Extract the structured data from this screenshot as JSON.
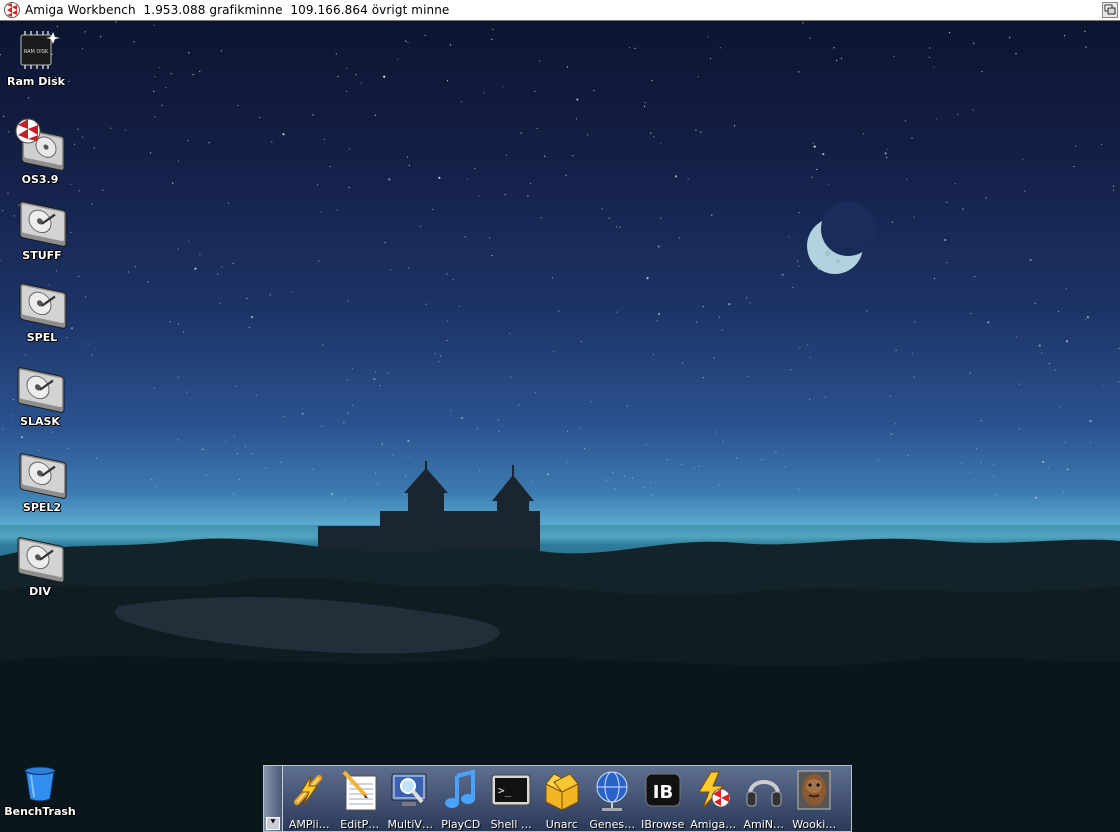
{
  "titlebar": {
    "title": "Amiga Workbench  1.953.088 grafikminne  109.166.864 övrigt minne",
    "left_icon": "boing-ball-icon",
    "right_icon": "depth-gadget-icon"
  },
  "desktop_icons": [
    {
      "label": "Ram Disk",
      "icon": "ram-disk-chip-icon",
      "chip_text": "RAM DISK"
    },
    {
      "label": "OS3.9",
      "icon": "boot-disk-icon"
    },
    {
      "label": "STUFF",
      "icon": "hard-disk-icon"
    },
    {
      "label": "SPEL",
      "icon": "hard-disk-icon"
    },
    {
      "label": "SLASK",
      "icon": "hard-disk-icon"
    },
    {
      "label": "SPEL2",
      "icon": "hard-disk-icon"
    },
    {
      "label": "DIV",
      "icon": "hard-disk-icon"
    },
    {
      "label": "BenchTrash",
      "icon": "trash-can-icon"
    }
  ],
  "dock": {
    "handle_arrow": "⯆",
    "items": [
      {
        "label": "AMPli…",
        "icon": "ampli-lightning-icon"
      },
      {
        "label": "EditP…",
        "icon": "notepad-pencil-icon"
      },
      {
        "label": "MultiV…",
        "icon": "magnifier-monitor-icon"
      },
      {
        "label": "PlayCD",
        "icon": "music-note-icon"
      },
      {
        "label": "Shell …",
        "icon": "terminal-icon",
        "glyph": ">_"
      },
      {
        "label": "Unarc",
        "icon": "open-box-icon"
      },
      {
        "label": "Genes…",
        "icon": "globe-network-icon"
      },
      {
        "label": "IBrowse",
        "icon": "ibrowse-logo-icon",
        "glyph": "IB"
      },
      {
        "label": "Amiga…",
        "icon": "amiga-boing-lightning-icon"
      },
      {
        "label": "AmiN…",
        "icon": "headphones-icon"
      },
      {
        "label": "Wooki…",
        "icon": "wookie-portrait-icon"
      }
    ]
  },
  "colors": {
    "titlebar_bg": "#ffffff",
    "sky_top": "#0c1530",
    "horizon": "#7fd2e6",
    "dock_bg": "#2a3958"
  }
}
